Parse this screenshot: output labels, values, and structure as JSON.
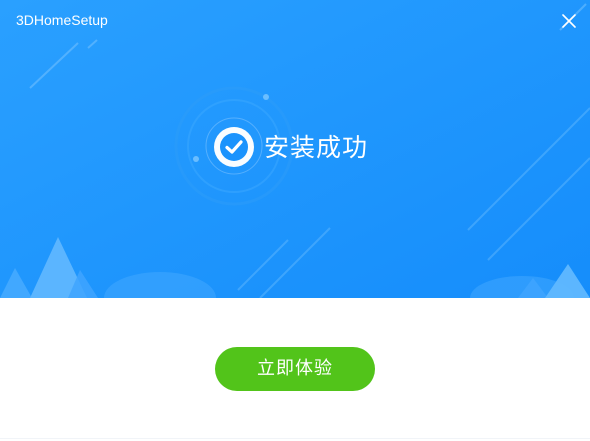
{
  "window": {
    "title": "3DHomeSetup"
  },
  "status": {
    "message": "安装成功",
    "icon": "check-circle-icon"
  },
  "actions": {
    "primary_label": "立即体验"
  },
  "colors": {
    "hero_blue": "#1a93fd",
    "button_green": "#52c41a",
    "white": "#ffffff"
  }
}
